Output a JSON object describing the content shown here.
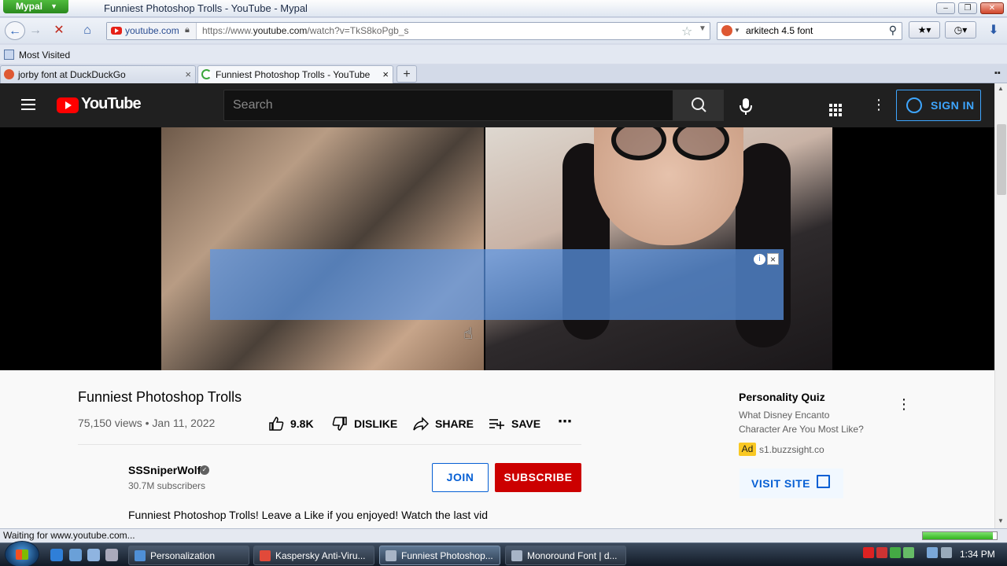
{
  "window": {
    "app_menu": "Mypal",
    "title": "Funniest Photoshop Trolls - YouTube - Mypal"
  },
  "navbar": {
    "identity_domain": "youtube.com",
    "url_prefix": "https://www.",
    "url_host": "youtube.com",
    "url_path": "/watch?v=TkS8koPgb_s",
    "search_value": "arkitech 4.5 font"
  },
  "bookmarks": {
    "most_visited": "Most Visited"
  },
  "tabs": [
    {
      "label": "jorby font at DuckDuckGo"
    },
    {
      "label": "Funniest Photoshop Trolls - YouTube"
    }
  ],
  "youtube": {
    "logo_text": "YouTube",
    "search_placeholder": "Search",
    "sign_in": "SIGN IN"
  },
  "video": {
    "title": "Funniest Photoshop Trolls",
    "views": "75,150 views",
    "date": "Jan 11, 2022",
    "likes": "9.8K",
    "dislike": "DISLIKE",
    "share": "SHARE",
    "save": "SAVE",
    "channel": "SSSniperWolf",
    "subscribers": "30.7M subscribers",
    "join": "JOIN",
    "subscribe": "SUBSCRIBE",
    "description": "Funniest Photoshop Trolls! Leave a Like if you enjoyed! Watch the last vid"
  },
  "ad": {
    "title": "Personality Quiz",
    "line1": "What Disney Encanto",
    "line2": "Character Are You Most Like?",
    "badge": "Ad",
    "domain": "s1.buzzsight.co",
    "visit": "VISIT SITE"
  },
  "status": {
    "text": "Waiting for www.youtube.com...",
    "progress_fraction": 0.95
  },
  "taskbar": {
    "tasks": [
      {
        "label": "Personalization"
      },
      {
        "label": "Kaspersky Anti-Viru..."
      },
      {
        "label": "Funniest Photoshop..."
      },
      {
        "label": "Monoround Font | d..."
      }
    ],
    "clock": "1:34 PM"
  },
  "colors": {
    "youtube_red": "#ff0000",
    "subscribe_red": "#cc0000",
    "link_blue": "#065fd4",
    "signin_blue": "#3ea6ff",
    "masthead": "#202020"
  }
}
